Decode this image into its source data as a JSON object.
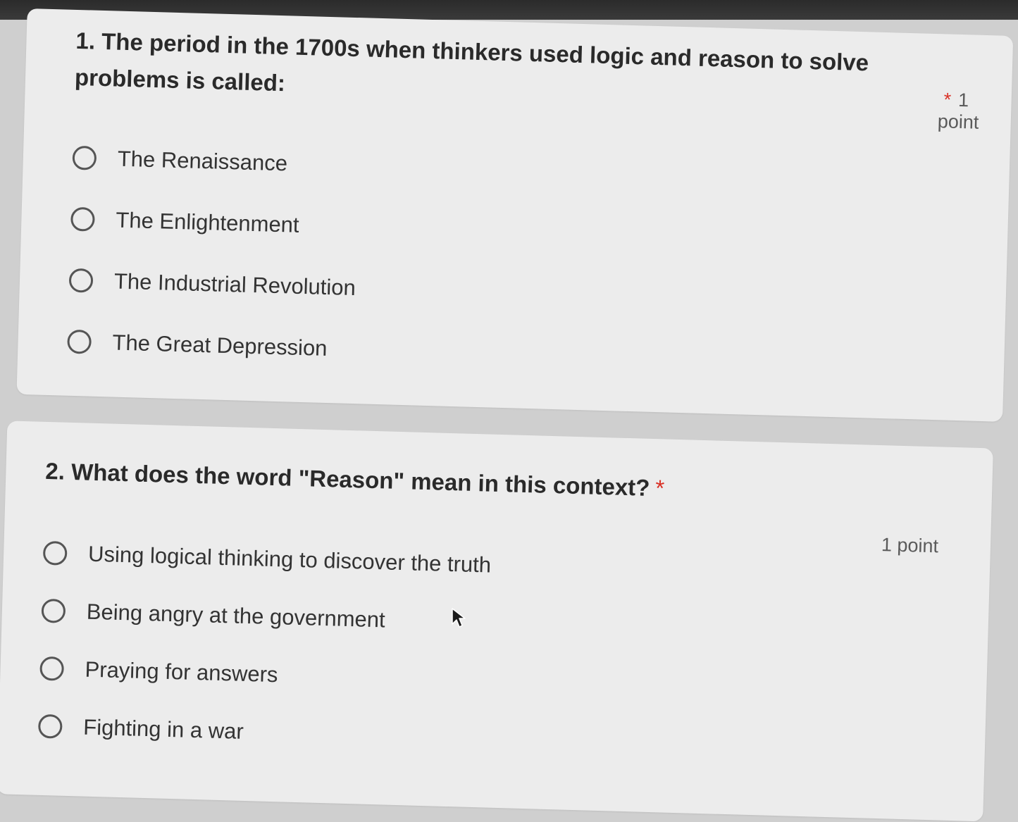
{
  "questions": [
    {
      "title": "1. The period in the 1700s when thinkers used logic and reason to solve problems is called:",
      "required_mark": "*",
      "points": "1 point",
      "options": [
        "The Renaissance",
        "The Enlightenment",
        "The Industrial Revolution",
        "The Great Depression"
      ]
    },
    {
      "title": "2. What does the word \"Reason\" mean in this context?",
      "required_mark": "*",
      "points": "1 point",
      "options": [
        "Using logical thinking to discover the truth",
        "Being angry at the government",
        "Praying for answers",
        "Fighting in a war"
      ]
    }
  ],
  "icons": {
    "cursor": "mouse-pointer-icon",
    "radio": "radio-unchecked-icon"
  },
  "colors": {
    "required": "#d93025",
    "card": "#ececec",
    "background": "#cfcfcf"
  }
}
